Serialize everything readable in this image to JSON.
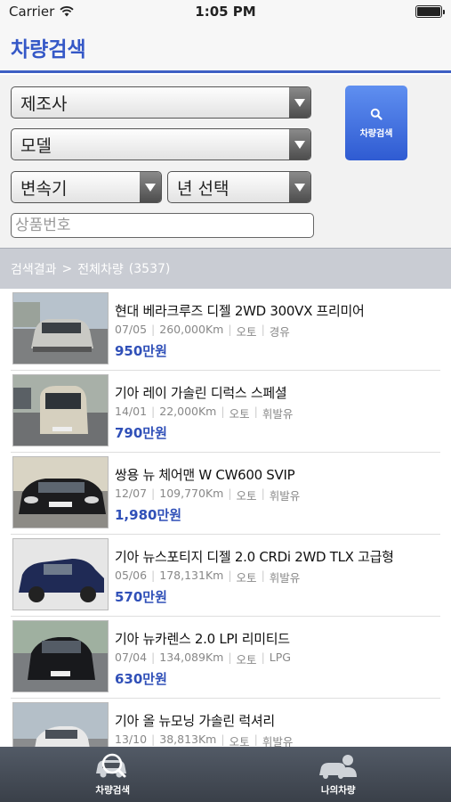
{
  "status_bar": {
    "carrier": "Carrier",
    "time": "1:05 PM"
  },
  "nav": {
    "title": "차량검색"
  },
  "search": {
    "maker_select": "제조사",
    "model_select": "모델",
    "transmission_select": "변속기",
    "year_select": "년 선택",
    "product_number_placeholder": "상품번호",
    "search_button": "차량검색"
  },
  "results": {
    "label": "검색결과",
    "separator": ">",
    "category": "전체차량",
    "count": "(3537)"
  },
  "cars": [
    {
      "title": "현대 베라크루즈 디젤 2WD 300VX 프리미어",
      "date": "07/05",
      "mileage": "260,000Km",
      "transmission": "오토",
      "fuel": "경유",
      "price": "950만원",
      "car_color": "#c9c9c4"
    },
    {
      "title": "기아 레이 가솔린 디럭스 스페셜",
      "date": "14/01",
      "mileage": "22,000Km",
      "transmission": "오토",
      "fuel": "휘발유",
      "price": "790만원",
      "car_color": "#d6d0bf"
    },
    {
      "title": "쌍용 뉴 체어맨 W CW600 SVIP",
      "date": "12/07",
      "mileage": "109,770Km",
      "transmission": "오토",
      "fuel": "휘발유",
      "price": "1,980만원",
      "car_color": "#1c1c1e"
    },
    {
      "title": "기아 뉴스포티지 디젤 2.0 CRDi 2WD TLX 고급형",
      "date": "05/06",
      "mileage": "178,131Km",
      "transmission": "오토",
      "fuel": "휘발유",
      "price": "570만원",
      "car_color": "#1f2a55"
    },
    {
      "title": "기아 뉴카렌스 2.0 LPI 리미티드",
      "date": "07/04",
      "mileage": "134,089Km",
      "transmission": "오토",
      "fuel": "LPG",
      "price": "630만원",
      "car_color": "#18191c"
    },
    {
      "title": "기아 올 뉴모닝 가솔린 럭셔리",
      "date": "13/10",
      "mileage": "38,813Km",
      "transmission": "오토",
      "fuel": "휘발유",
      "price": "",
      "car_color": "#e8e8e8"
    }
  ],
  "tabs": [
    {
      "label": "차량검색",
      "icon": "car-search-icon"
    },
    {
      "label": "나의차량",
      "icon": "my-car-icon"
    }
  ],
  "colors": {
    "accent": "#3558c7",
    "price": "#3050b8",
    "tab_bar": "#4a5059"
  }
}
